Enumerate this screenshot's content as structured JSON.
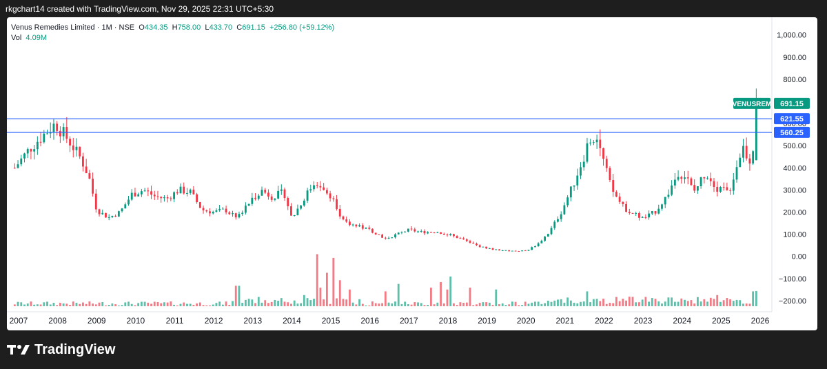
{
  "header": {
    "caption": "rkgchart14 created with TradingView.com, Nov 29, 2025 22:31 UTC+5:30"
  },
  "legend": {
    "symbol_line": "Venus Remedies Limited · 1M · NSE",
    "o_label": "O",
    "o_value": "434.35",
    "h_label": "H",
    "h_value": "758.00",
    "l_label": "L",
    "l_value": "433.70",
    "c_label": "C",
    "c_value": "691.15",
    "change": "+256.80 (+59.12%)",
    "vol_label": "Vol",
    "vol_value": "4.09M"
  },
  "footer": {
    "brand": "TradingView"
  },
  "chart_data": {
    "type": "candlestick",
    "interval": "1M",
    "exchange": "NSE",
    "symbol": "VENUSREM",
    "y_axis": {
      "range": [
        -250,
        1080
      ],
      "ticks": [
        "1,000.00",
        "900.00",
        "800.00",
        "700.00",
        "600.00",
        "500.00",
        "400.00",
        "300.00",
        "200.00",
        "100.00",
        "0.00",
        "−100.00",
        "−200.00"
      ],
      "tick_values": [
        1000,
        900,
        800,
        700,
        600,
        500,
        400,
        300,
        200,
        100,
        0,
        -100,
        -200
      ]
    },
    "x_axis": {
      "range": [
        2006.7,
        2026.3
      ],
      "ticks": [
        "2007",
        "2008",
        "2009",
        "2010",
        "2011",
        "2012",
        "2013",
        "2014",
        "2015",
        "2016",
        "2017",
        "2018",
        "2019",
        "2020",
        "2021",
        "2022",
        "2023",
        "2024",
        "2025",
        "2026"
      ],
      "tick_values": [
        2007,
        2008,
        2009,
        2010,
        2011,
        2012,
        2013,
        2014,
        2015,
        2016,
        2017,
        2018,
        2019,
        2020,
        2021,
        2022,
        2023,
        2024,
        2025,
        2026
      ]
    },
    "horizontal_lines": [
      {
        "label": "621.55",
        "value": 621.55,
        "color": "#2962ff"
      },
      {
        "label": "560.25",
        "value": 560.25,
        "color": "#2962ff"
      }
    ],
    "last_price": {
      "symbol": "VENUSREM",
      "label": "691.15",
      "value": 691.15,
      "color": "#089981"
    },
    "colors": {
      "up": "#089981",
      "down": "#f23645",
      "vol_up": "#5dbfa9",
      "vol_down": "#f27b85"
    },
    "volume_scale": {
      "max_volume_m": 28,
      "baseline_value": -225,
      "max_value": 10
    },
    "anchors": [
      [
        2006.9,
        400
      ],
      [
        2007.3,
        490
      ],
      [
        2007.7,
        560
      ],
      [
        2007.95,
        600
      ],
      [
        2008.3,
        520
      ],
      [
        2008.6,
        440
      ],
      [
        2008.8,
        360
      ],
      [
        2009.0,
        210
      ],
      [
        2009.3,
        175
      ],
      [
        2009.6,
        200
      ],
      [
        2009.9,
        280
      ],
      [
        2010.2,
        300
      ],
      [
        2010.5,
        270
      ],
      [
        2010.8,
        260
      ],
      [
        2011.1,
        300
      ],
      [
        2011.4,
        290
      ],
      [
        2011.7,
        210
      ],
      [
        2012.0,
        200
      ],
      [
        2012.3,
        210
      ],
      [
        2012.6,
        170
      ],
      [
        2012.9,
        240
      ],
      [
        2013.2,
        300
      ],
      [
        2013.5,
        270
      ],
      [
        2013.8,
        290
      ],
      [
        2014.0,
        170
      ],
      [
        2014.3,
        260
      ],
      [
        2014.6,
        340
      ],
      [
        2014.9,
        300
      ],
      [
        2015.1,
        250
      ],
      [
        2015.3,
        160
      ],
      [
        2015.6,
        140
      ],
      [
        2016.0,
        120
      ],
      [
        2016.4,
        80
      ],
      [
        2016.7,
        100
      ],
      [
        2017.0,
        120
      ],
      [
        2017.3,
        110
      ],
      [
        2017.7,
        110
      ],
      [
        2018.0,
        100
      ],
      [
        2018.4,
        75
      ],
      [
        2018.8,
        45
      ],
      [
        2019.2,
        30
      ],
      [
        2019.6,
        25
      ],
      [
        2020.0,
        25
      ],
      [
        2020.3,
        55
      ],
      [
        2020.6,
        110
      ],
      [
        2020.9,
        200
      ],
      [
        2021.2,
        320
      ],
      [
        2021.5,
        460
      ],
      [
        2021.6,
        520
      ],
      [
        2021.8,
        560
      ],
      [
        2022.0,
        420
      ],
      [
        2022.2,
        300
      ],
      [
        2022.5,
        220
      ],
      [
        2022.8,
        190
      ],
      [
        2023.0,
        170
      ],
      [
        2023.3,
        200
      ],
      [
        2023.6,
        270
      ],
      [
        2023.9,
        380
      ],
      [
        2024.1,
        360
      ],
      [
        2024.3,
        290
      ],
      [
        2024.6,
        380
      ],
      [
        2024.9,
        310
      ],
      [
        2025.2,
        290
      ],
      [
        2025.4,
        410
      ],
      [
        2025.55,
        500
      ],
      [
        2025.7,
        440
      ],
      [
        2025.8,
        434
      ],
      [
        2025.87,
        691
      ]
    ],
    "volume_spikes": [
      [
        2012.55,
        11
      ],
      [
        2012.68,
        11
      ],
      [
        2014.28,
        6
      ],
      [
        2014.62,
        28
      ],
      [
        2014.72,
        10
      ],
      [
        2014.9,
        18
      ],
      [
        2015.08,
        26
      ],
      [
        2015.25,
        14
      ],
      [
        2015.45,
        9
      ],
      [
        2016.4,
        8
      ],
      [
        2016.7,
        12
      ],
      [
        2017.6,
        10
      ],
      [
        2017.85,
        13
      ],
      [
        2018.0,
        9
      ],
      [
        2018.05,
        16
      ],
      [
        2018.55,
        10
      ],
      [
        2019.2,
        9
      ],
      [
        2021.55,
        8
      ],
      [
        2022.3,
        5
      ],
      [
        2024.9,
        6
      ],
      [
        2025.85,
        8
      ]
    ],
    "final_candle": {
      "x": 2025.9,
      "open": 434.35,
      "high": 758.0,
      "low": 433.7,
      "close": 691.15,
      "volume_m": 4.09
    }
  }
}
